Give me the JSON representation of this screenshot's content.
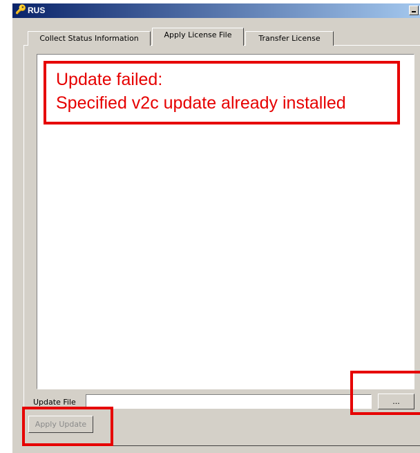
{
  "window": {
    "title": "RUS",
    "icon": "key-icon"
  },
  "tabs": [
    {
      "label": "Collect Status Information",
      "active": false
    },
    {
      "label": "Apply License File",
      "active": true
    },
    {
      "label": "Transfer License",
      "active": false
    }
  ],
  "apply_license": {
    "log_text": "",
    "update_file_label": "Update File",
    "update_file_value": "",
    "browse_label": "...",
    "apply_label": "Apply Update",
    "apply_enabled": false
  },
  "annotation": {
    "lines": [
      "Update failed:",
      "Specified v2c update already installed"
    ],
    "color": "#e60000"
  },
  "colors": {
    "title_start": "#0a246a",
    "title_end": "#a6caf0",
    "face": "#d4d0c8"
  }
}
